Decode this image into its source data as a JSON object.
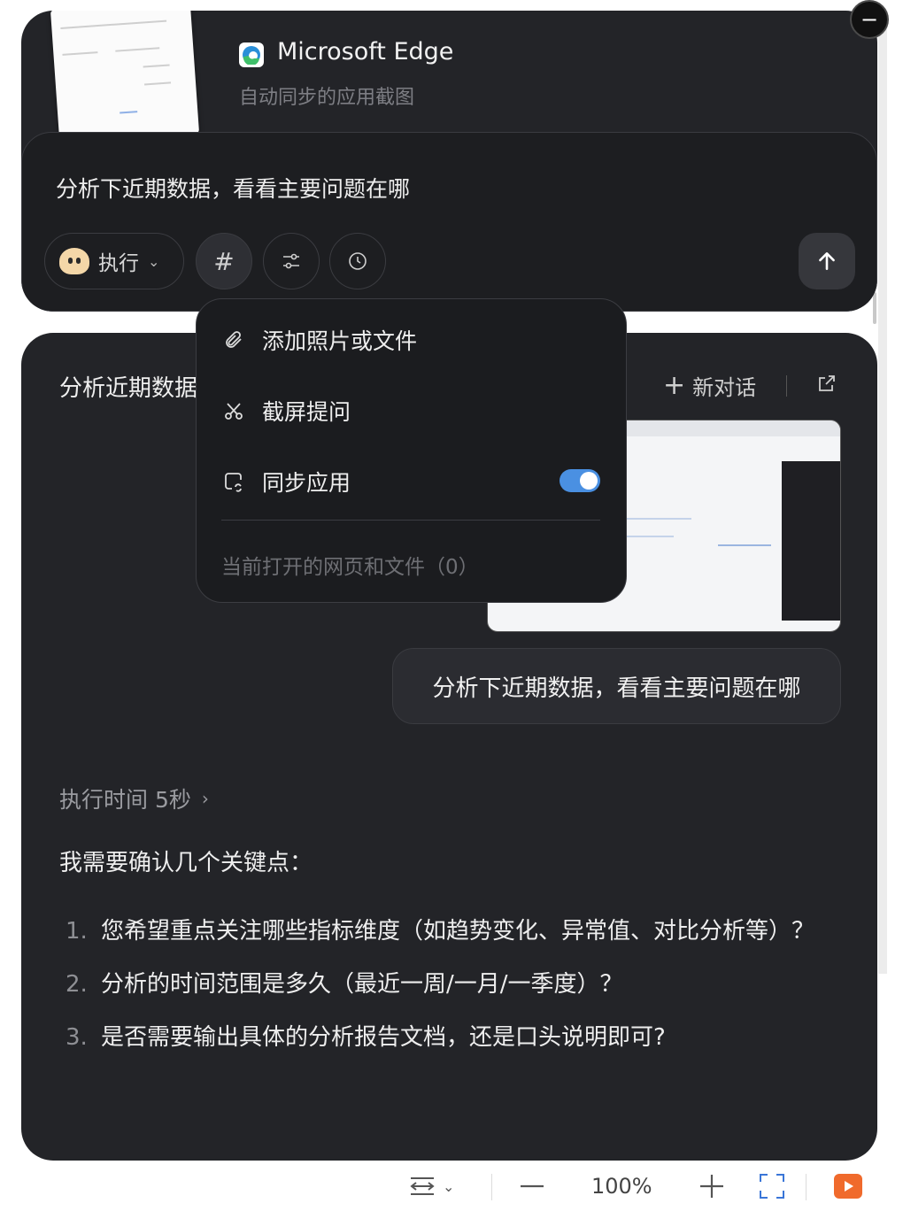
{
  "app": {
    "name": "Microsoft Edge",
    "subtitle": "自动同步的应用截图"
  },
  "composer": {
    "input_text": "分析下近期数据，看看主要问题在哪",
    "mode_label": "执行",
    "hash_symbol": "#"
  },
  "menu": {
    "items": [
      {
        "label": "添加照片或文件",
        "icon": "paperclip-icon"
      },
      {
        "label": "截屏提问",
        "icon": "scissors-icon"
      },
      {
        "label": "同步应用",
        "icon": "sync-app-icon",
        "toggle_on": true
      }
    ],
    "footer": "当前打开的网页和文件（0）"
  },
  "conversation": {
    "title": "分析近期数据",
    "new_chat_label": "新对话",
    "user_message": "分析下近期数据，看看主要问题在哪",
    "exec_time": "执行时间 5秒",
    "intro": "我需要确认几个关键点：",
    "questions": [
      {
        "num": "1.",
        "text": "您希望重点关注哪些指标维度（如趋势变化、异常值、对比分析等）？"
      },
      {
        "num": "2.",
        "text": "分析的时间范围是多久（最近一周/一月/一季度）？"
      },
      {
        "num": "3.",
        "text": "是否需要输出具体的分析报告文档，还是口头说明即可?"
      }
    ]
  },
  "toolbar": {
    "zoom": "100%"
  },
  "colors": {
    "toggle_on": "#4a90e2",
    "record": "#f06a2c"
  }
}
